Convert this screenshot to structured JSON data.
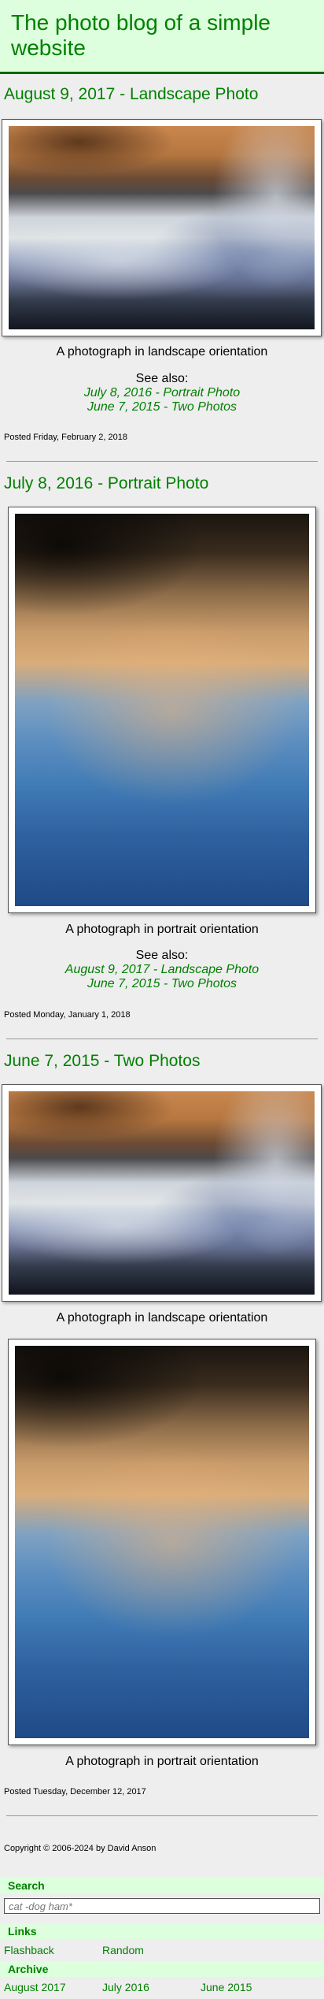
{
  "site": {
    "title": "The photo blog of a simple website"
  },
  "posts": [
    {
      "title": "August 9, 2017 - Landscape Photo",
      "captions": [
        "A photograph in landscape orientation"
      ],
      "see_also_label": "See also:",
      "see_also": [
        "July 8, 2016 - Portrait Photo",
        "June 7, 2015 - Two Photos"
      ],
      "posted": "Posted Friday, February 2, 2018"
    },
    {
      "title": "July 8, 2016 - Portrait Photo",
      "captions": [
        "A photograph in portrait orientation"
      ],
      "see_also_label": "See also:",
      "see_also": [
        "August 9, 2017 - Landscape Photo",
        "June 7, 2015 - Two Photos"
      ],
      "posted": "Posted Monday, January 1, 2018"
    },
    {
      "title": "June 7, 2015 - Two Photos",
      "captions": [
        "A photograph in landscape orientation",
        "A photograph in portrait orientation"
      ],
      "posted": "Posted Tuesday, December 12, 2017"
    }
  ],
  "footer": {
    "copyright": "Copyright © 2006-2024 by David Anson"
  },
  "sidebar": {
    "search": {
      "heading": "Search",
      "placeholder": "cat -dog ham*"
    },
    "links": {
      "heading": "Links",
      "items": [
        "Flashback",
        "Random"
      ]
    },
    "archive": {
      "heading": "Archive",
      "items": [
        "August 2017",
        "July 2016",
        "June 2015"
      ]
    }
  },
  "colors": {
    "accent": "#008000",
    "header_bg": "#ddffdd",
    "page_bg": "#eeeeee"
  }
}
